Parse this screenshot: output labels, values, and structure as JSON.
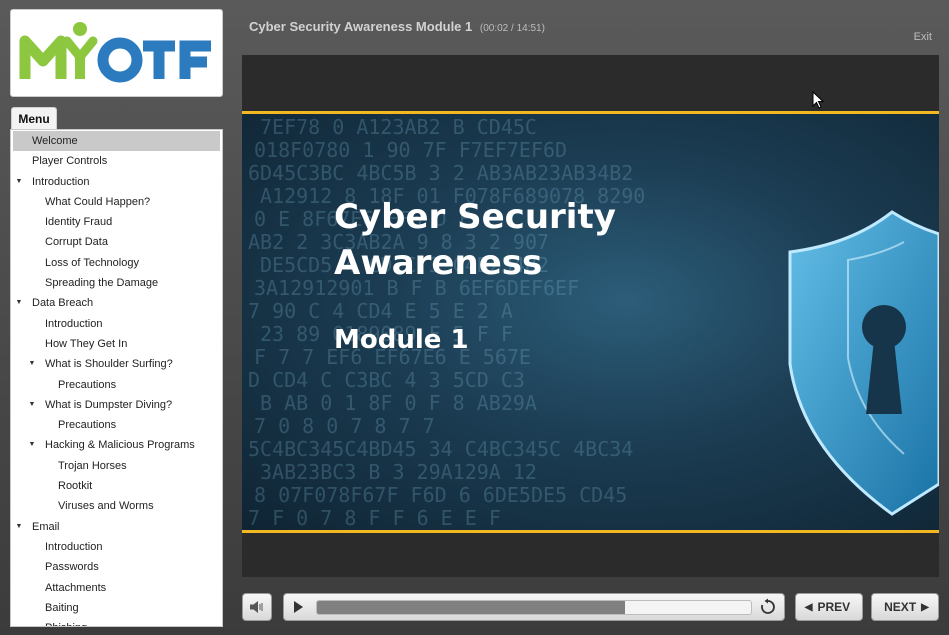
{
  "logo": {
    "text": "MYOTF",
    "alt": "MyOTF logo",
    "colors": {
      "green": "#8dc63f",
      "blue": "#2c7bbf"
    }
  },
  "menu": {
    "tab_label": "Menu",
    "items": [
      {
        "label": "Welcome",
        "level": 0,
        "caret": false,
        "selected": true
      },
      {
        "label": "Player Controls",
        "level": 0,
        "caret": false
      },
      {
        "label": "Introduction",
        "level": 0,
        "caret": true
      },
      {
        "label": "What Could Happen?",
        "level": 1,
        "caret": false
      },
      {
        "label": "Identity Fraud",
        "level": 1,
        "caret": false
      },
      {
        "label": "Corrupt Data",
        "level": 1,
        "caret": false
      },
      {
        "label": "Loss of Technology",
        "level": 1,
        "caret": false
      },
      {
        "label": "Spreading the Damage",
        "level": 1,
        "caret": false
      },
      {
        "label": "Data Breach",
        "level": 0,
        "caret": true
      },
      {
        "label": "Introduction",
        "level": 1,
        "caret": false
      },
      {
        "label": "How They Get In",
        "level": 1,
        "caret": false
      },
      {
        "label": "What is Shoulder Surfing?",
        "level": 1,
        "caret": true
      },
      {
        "label": "Precautions",
        "level": 2,
        "caret": false
      },
      {
        "label": "What is Dumpster Diving?",
        "level": 1,
        "caret": true
      },
      {
        "label": "Precautions",
        "level": 2,
        "caret": false
      },
      {
        "label": "Hacking & Malicious Programs",
        "level": 1,
        "caret": true
      },
      {
        "label": "Trojan Horses",
        "level": 2,
        "caret": false
      },
      {
        "label": "Rootkit",
        "level": 2,
        "caret": false
      },
      {
        "label": "Viruses and Worms",
        "level": 2,
        "caret": false
      },
      {
        "label": "Email",
        "level": 0,
        "caret": true
      },
      {
        "label": "Introduction",
        "level": 1,
        "caret": false
      },
      {
        "label": "Passwords",
        "level": 1,
        "caret": false
      },
      {
        "label": "Attachments",
        "level": 1,
        "caret": false
      },
      {
        "label": "Baiting",
        "level": 1,
        "caret": false
      },
      {
        "label": "Phishing",
        "level": 1,
        "caret": false,
        "clipped": true
      }
    ]
  },
  "header": {
    "title": "Cyber Security Awareness Module 1",
    "time": "(00:02 / 14:51)",
    "exit_label": "Exit"
  },
  "slide": {
    "title": "Cyber Security Awareness",
    "subtitle": "Module 1",
    "accent_color": "#f3b722",
    "hex_rows": [
      "7EF78  0  A123AB2 B   CD45C",
      "018F0780  1 90 7F F7EF7EF6D",
      "6D45C3BC 4BC5B 3 2 AB3AB23AB34B2",
      "A12912  8 18F 01 F078F689078 8290",
      "0  E  8F67E6  EF6 D F E",
      "AB2 2 3C3AB2A  9  8  3  2  907",
      "DE5CD5 4 CD C 3 C4B234B2",
      "3A12912901 B F B  6EF6DEF6EF",
      "7  90  C 4  CD4  E 5 E  2 A",
      "23  89 0189089   F 5 F F",
      "F 7 7  EF6  EF67E6 E 567E",
      "D CD4  C C3BC 4 3 5CD C3",
      "B AB 0 1 8F 0  F 8 AB29A",
      "7  0 8  0    7 8 7  7",
      "5C4BC345C4BD45 34 C4BC345C 4BC34",
      "3AB23BC3   B 3 29A129A 12",
      "8 07F078F67F F6D 6 6DE5DE5 CD45",
      "7 F 0 7 8 F   F 6 E  E F"
    ]
  },
  "controls": {
    "volume_icon": "speaker-icon",
    "play_icon": "play-icon",
    "replay_icon": "replay-icon",
    "progress": 0.71,
    "prev_label": "PREV",
    "next_label": "NEXT"
  }
}
